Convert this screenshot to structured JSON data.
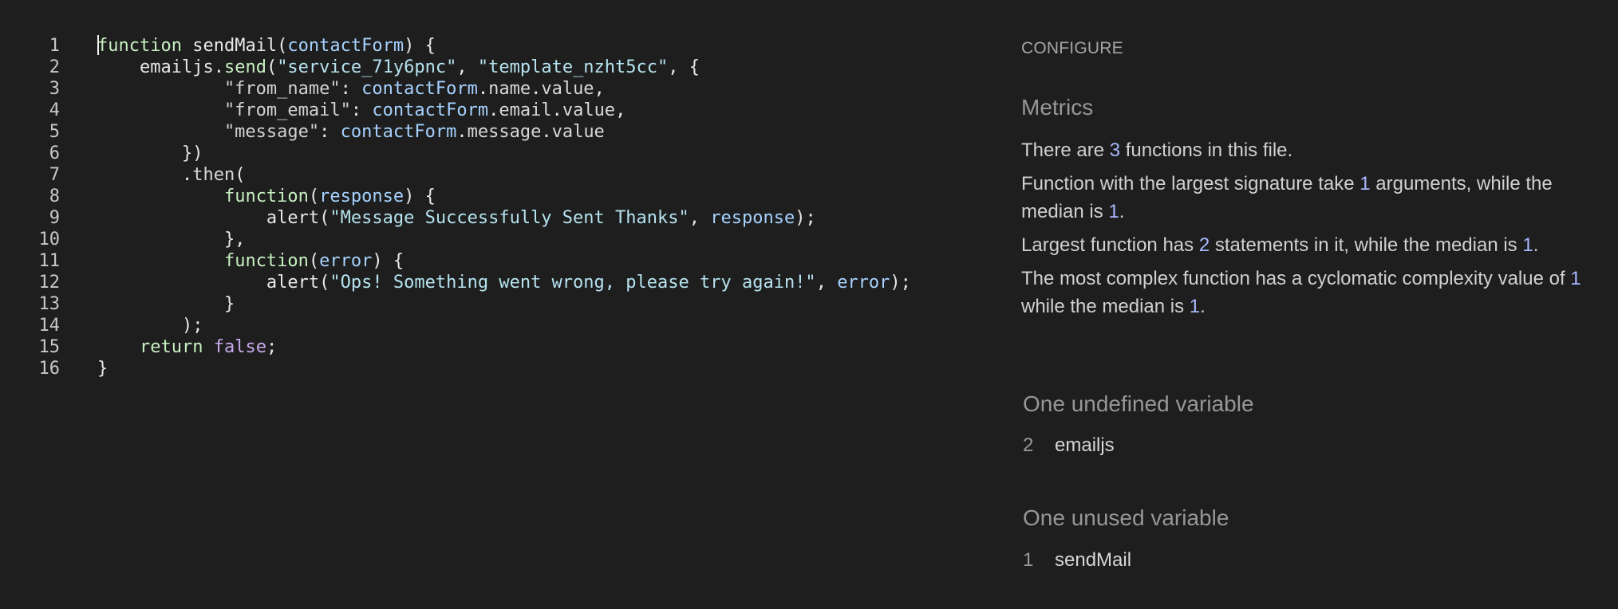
{
  "editor": {
    "lines": [
      {
        "num": "1",
        "tokens": [
          "function",
          " sendMail(",
          "contactForm",
          ") {"
        ]
      },
      {
        "num": "2",
        "tokens": [
          "    emailjs.",
          "send",
          "(",
          "\"service_71y6pnc\"",
          ", ",
          "\"template_nzht5cc\"",
          ", {"
        ]
      },
      {
        "num": "3",
        "tokens": [
          "            \"from_name\"",
          ": ",
          "contactForm",
          ".",
          "name",
          ".",
          "value",
          ","
        ]
      },
      {
        "num": "4",
        "tokens": [
          "            \"from_email\"",
          ": ",
          "contactForm",
          ".",
          "email",
          ".",
          "value",
          ","
        ]
      },
      {
        "num": "5",
        "tokens": [
          "            \"message\"",
          ": ",
          "contactForm",
          ".",
          "message",
          ".",
          "value"
        ]
      },
      {
        "num": "6",
        "tokens": [
          "        })"
        ]
      },
      {
        "num": "7",
        "tokens": [
          "        .",
          "then",
          "("
        ]
      },
      {
        "num": "8",
        "tokens": [
          "            ",
          "function",
          "(",
          "response",
          ") {"
        ]
      },
      {
        "num": "9",
        "tokens": [
          "                alert(",
          "\"Message Successfully Sent Thanks\"",
          ", ",
          "response",
          ");"
        ]
      },
      {
        "num": "10",
        "tokens": [
          "            },"
        ]
      },
      {
        "num": "11",
        "tokens": [
          "            ",
          "function",
          "(",
          "error",
          ") {"
        ]
      },
      {
        "num": "12",
        "tokens": [
          "                alert(",
          "\"Ops! Something went wrong, please try again!\"",
          ", ",
          "error",
          ");"
        ]
      },
      {
        "num": "13",
        "tokens": [
          "            }"
        ]
      },
      {
        "num": "14",
        "tokens": [
          "        );"
        ]
      },
      {
        "num": "15",
        "tokens": [
          "    ",
          "return",
          " ",
          "false",
          ";"
        ]
      },
      {
        "num": "16",
        "tokens": [
          "}"
        ]
      }
    ]
  },
  "panel": {
    "configure_label": "CONFIGURE",
    "metrics_heading": "Metrics",
    "metric_1": [
      "There are ",
      "3",
      " functions in this file."
    ],
    "metric_2": [
      "Function with the largest signature take ",
      "1",
      " arguments, while the median is ",
      "1",
      "."
    ],
    "metric_3": [
      "Largest function has ",
      "2",
      " statements in it, while the median is ",
      "1",
      "."
    ],
    "metric_4": [
      "The most complex function has a cyclomatic complexity value of ",
      "1",
      " while the median is ",
      "1",
      "."
    ],
    "undefined_heading": "One undefined variable",
    "undefined_vars": [
      {
        "line": "2",
        "name": "emailjs"
      }
    ],
    "unused_heading": "One unused variable",
    "unused_vars": [
      {
        "line": "1",
        "name": "sendMail"
      }
    ]
  }
}
